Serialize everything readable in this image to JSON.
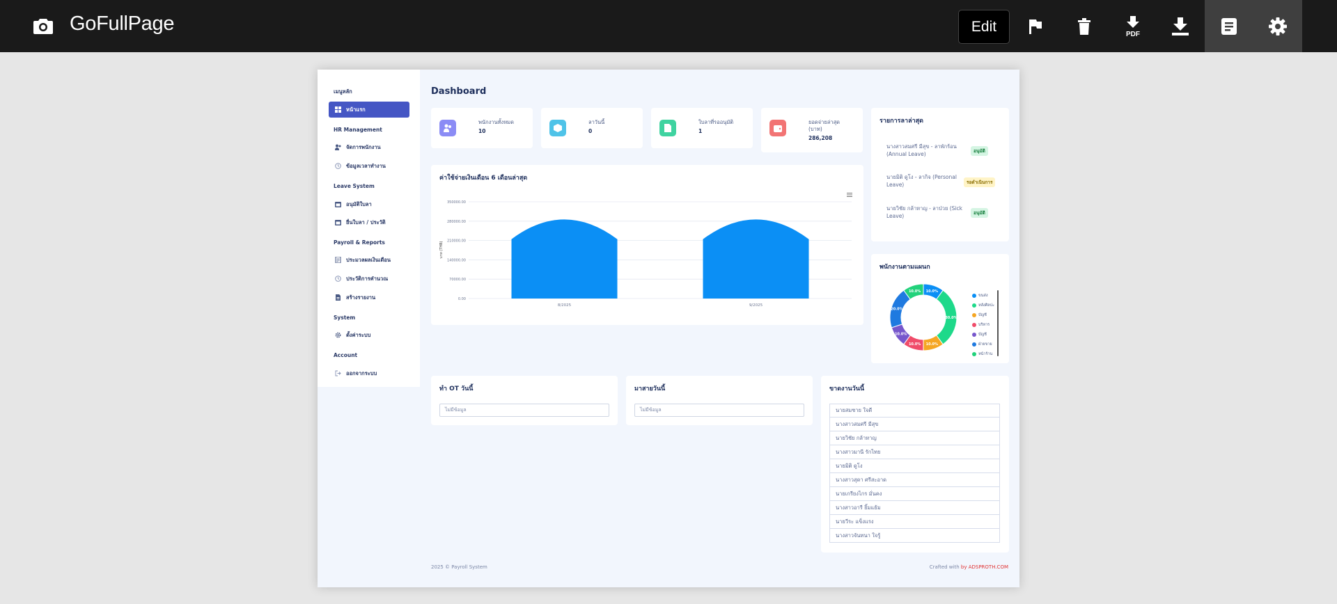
{
  "toolbar": {
    "brand": "GoFullPage",
    "edit_label": "Edit",
    "pdf_label": "PDF"
  },
  "sidebar": {
    "sections": [
      {
        "title": "เมนูหลัก",
        "items": [
          {
            "label": "หน้าแรก",
            "icon": "grid-icon",
            "active": true
          }
        ]
      },
      {
        "title": "HR Management",
        "items": [
          {
            "label": "จัดการพนักงาน",
            "icon": "users-icon"
          },
          {
            "label": "ข้อมูลเวลาทำงาน",
            "icon": "clock-icon"
          }
        ]
      },
      {
        "title": "Leave System",
        "items": [
          {
            "label": "อนุมัติใบลา",
            "icon": "calendar-icon"
          },
          {
            "label": "ยื่นใบลา / ประวัติ",
            "icon": "calendar-icon"
          }
        ]
      },
      {
        "title": "Payroll & Reports",
        "items": [
          {
            "label": "ประมวลผลเงินเดือน",
            "icon": "document-icon"
          },
          {
            "label": "ประวัติการคำนวณ",
            "icon": "clock-icon"
          },
          {
            "label": "สร้างรายงาน",
            "icon": "file-icon"
          }
        ]
      },
      {
        "title": "System",
        "items": [
          {
            "label": "ตั้งค่าระบบ",
            "icon": "gear-icon"
          }
        ]
      },
      {
        "title": "Account",
        "items": [
          {
            "label": "ออกจากระบบ",
            "icon": "logout-icon"
          }
        ]
      }
    ]
  },
  "dashboard": {
    "title": "Dashboard",
    "stats": [
      {
        "label": "พนักงานทั้งหมด",
        "value": "10",
        "color": "#8b8cf5",
        "icon": "users-icon"
      },
      {
        "label": "ลาวันนี้",
        "value": "0",
        "color": "#4fc3e8",
        "icon": "box-icon"
      },
      {
        "label": "ใบลาที่รออนุมัติ",
        "value": "1",
        "color": "#3fd3a0",
        "icon": "file-icon"
      },
      {
        "label": "ยอดจ่ายล่าสุด (บาท)",
        "value": "286,208",
        "color": "#f27474",
        "icon": "wallet-icon"
      }
    ],
    "recent_leaves": {
      "title": "รายการลาล่าสุด",
      "items": [
        {
          "text": "นางสาวสมศรี มีสุข - ลาพักร้อน (Annual Leave)",
          "status": "อนุมัติ",
          "status_type": "ok"
        },
        {
          "text": "นายมิติ ดูโง - ลากิจ (Personal Leave)",
          "status": "รอดำเนินการ",
          "status_type": "wait"
        },
        {
          "text": "นายวิชัย กล้าหาญ - ลาป่วย (Sick Leave)",
          "status": "อนุมัติ",
          "status_type": "ok"
        }
      ]
    },
    "ot_today": {
      "title": "ทำ OT วันนี้",
      "empty": "ไม่มีข้อมูล"
    },
    "late_today": {
      "title": "มาสายวันนี้",
      "empty": "ไม่มีข้อมูล"
    },
    "absent_today": {
      "title": "ขาดงานวันนี้",
      "items": [
        "นายสมชาย ใจดี",
        "นางสาวสมศรี มีสุข",
        "นายวิชัย กล้าหาญ",
        "นางสาวมานี รักไทย",
        "นายมิติ ดูโง",
        "นางสาวสุดา ศรีสะอาด",
        "นายเกรียงไกร มั่นคง",
        "นางสาวอารี ยิ้มแย้ม",
        "นายวีระ แข็งแรง",
        "นางสาวจันทนา ใจรู้"
      ]
    }
  },
  "chart_data": [
    {
      "type": "area",
      "title": "ค่าใช้จ่ายเงินเดือน 6 เดือนล่าสุด",
      "ylabel": "บาท (THB)",
      "x": [
        "8/2025",
        "9/2025"
      ],
      "values": [
        286208,
        286208
      ],
      "y_ticks": [
        "0.00",
        "70000.00",
        "140000.00",
        "210000.00",
        "280000.00",
        "350000.00"
      ],
      "ylim": [
        0,
        350000
      ],
      "grid": true,
      "color": "#0b8ff5"
    },
    {
      "type": "pie",
      "title": "พนักงานตามแผนก",
      "categories": [
        "ขนส่ง",
        "หลังศิลปะ",
        "บัญชี",
        "บริหาร",
        "บัญชี",
        "ฝ่ายขาย",
        "หน้าร้าน"
      ],
      "values": [
        10,
        30,
        10,
        10,
        10,
        20,
        10
      ],
      "slice_labels": [
        "10.0%",
        "30.0%",
        "10.0%",
        "10.0%",
        "10.0%",
        "20.0%",
        "10.0%"
      ],
      "colors": [
        "#0b8ff5",
        "#1ed98a",
        "#f5a623",
        "#f04c6a",
        "#7757cc",
        "#1f7ae0",
        "#22d27b"
      ],
      "legend": "right"
    }
  ],
  "footer": {
    "left": "2025 © Payroll System",
    "right_prefix": "Crafted with ",
    "right_link": "by ADSPROTH.COM"
  }
}
